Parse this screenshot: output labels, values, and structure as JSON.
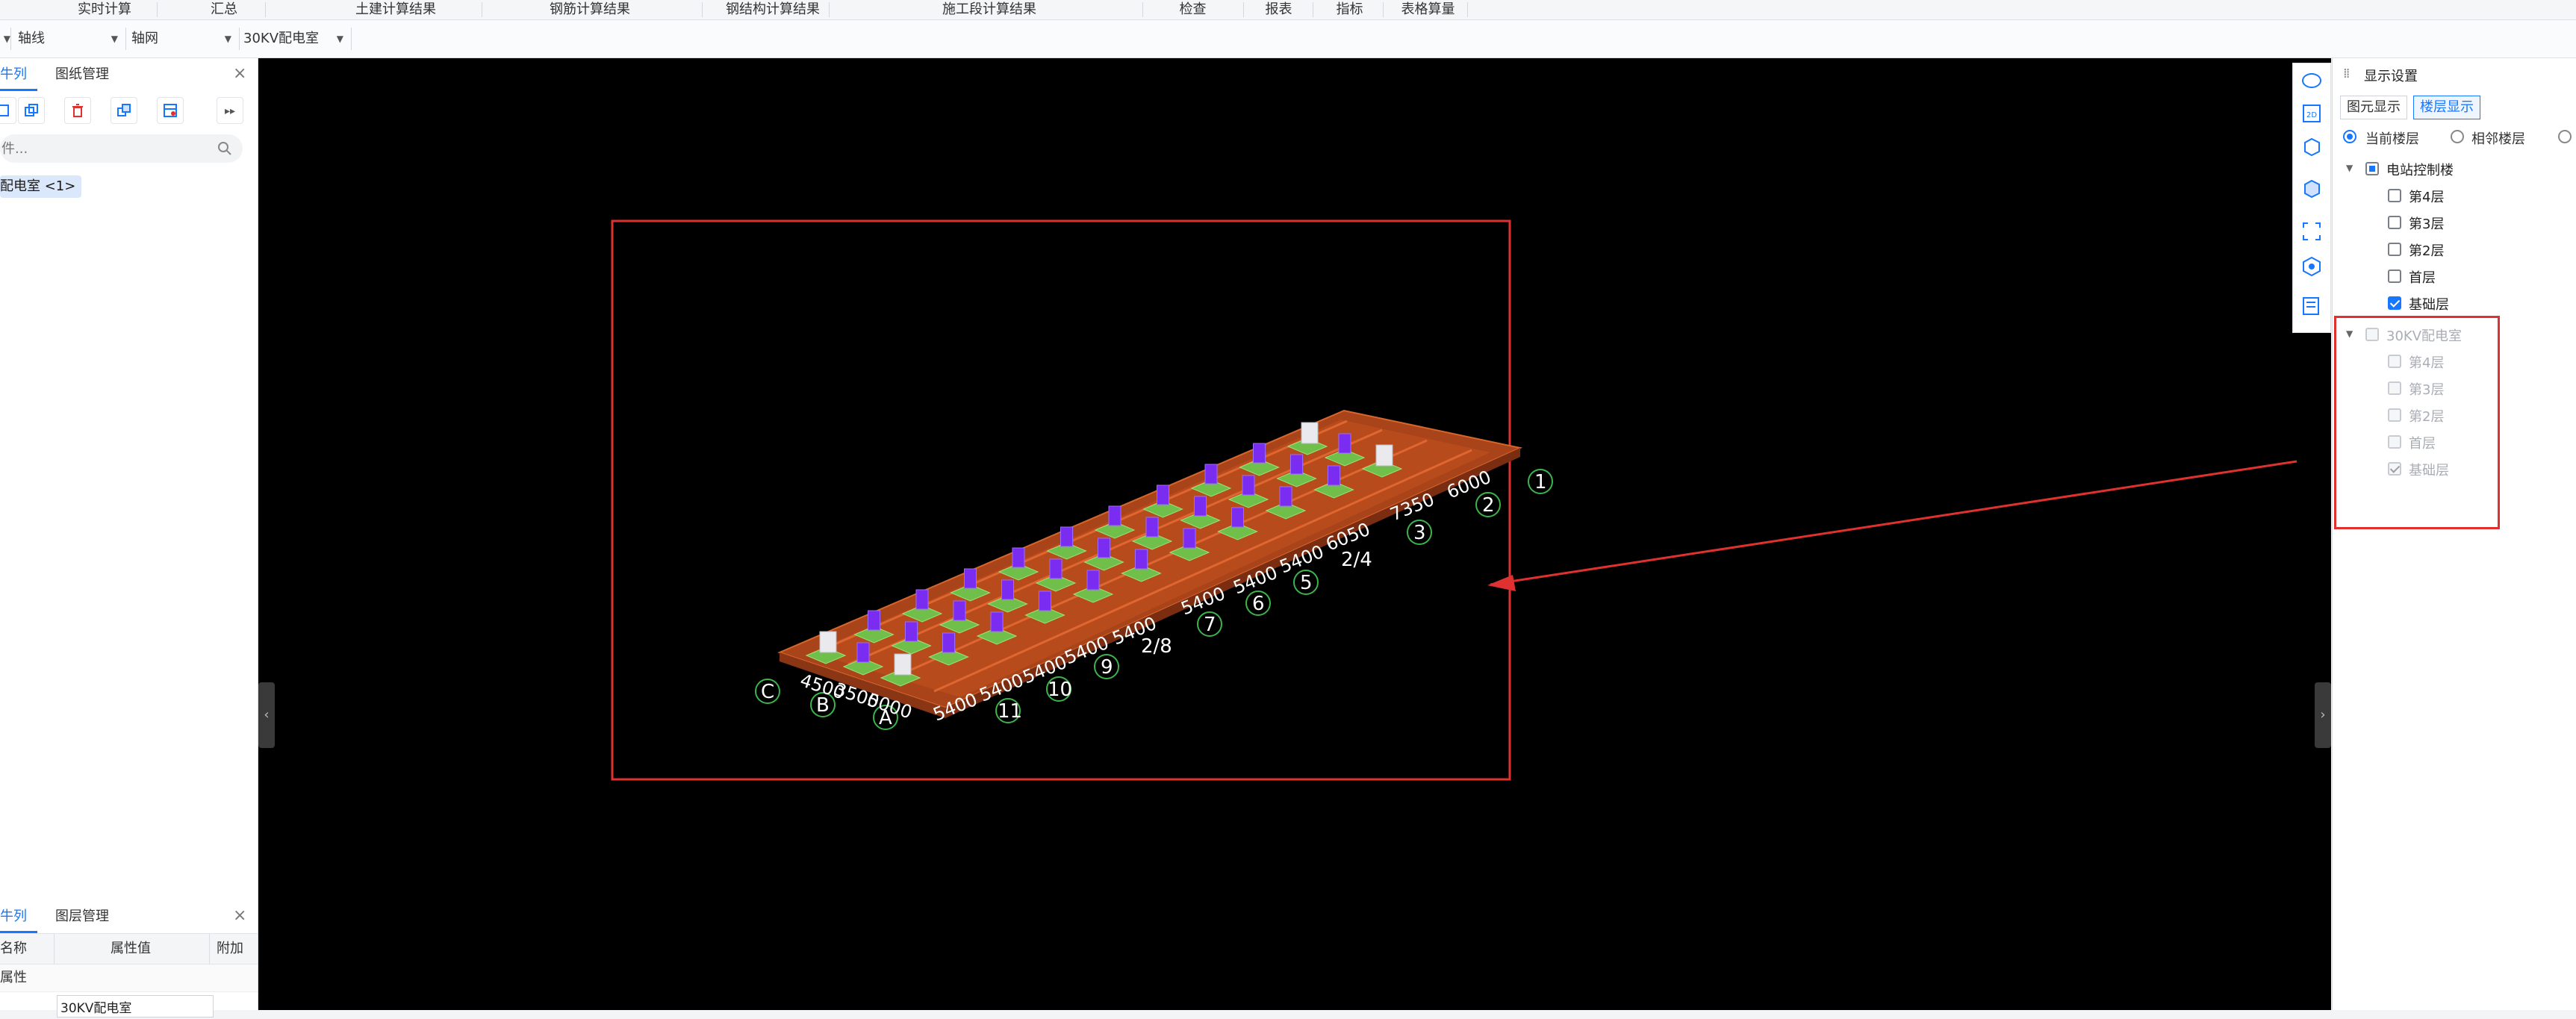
{
  "ribbon": {
    "items": [
      "实时计算",
      "汇总",
      "土建计算结果",
      "钢筋计算结果",
      "钢结构计算结果",
      "施工段计算结果",
      "检查",
      "报表",
      "指标",
      "表格算量"
    ]
  },
  "toolbar": {
    "dropdown_1": "轴线",
    "dropdown_2": "轴网",
    "dropdown_3": "30KV配电室"
  },
  "left_panel": {
    "tab_component_list": "牛列表",
    "tab_drawing_manage": "图纸管理",
    "search_placeholder": "件...",
    "tree_item": "配电室 <1>",
    "bottom_tab_attr_list": "牛列表",
    "bottom_tab_layer_manage": "图层管理",
    "prop_col_name": "名称",
    "prop_col_value": "属性值",
    "prop_col_extra": "附加",
    "prop_group": "属性",
    "prop_value": "30KV配电室"
  },
  "viewport": {
    "axis_numbers": [
      "1",
      "2",
      "3",
      "2/4",
      "5",
      "6",
      "7",
      "2/8",
      "9",
      "10",
      "11"
    ],
    "axis_letters": [
      "C",
      "B",
      "A"
    ],
    "dims_top": [
      "6000",
      "7350",
      "6050",
      "5400",
      "5400",
      "5400"
    ],
    "dims_bottom": [
      "5400",
      "5400",
      "5400",
      "5400",
      "5400"
    ],
    "dims_left": [
      "4500",
      "3500",
      "5000"
    ]
  },
  "right_panel": {
    "title": "显示设置",
    "tab_element_display": "图元显示",
    "tab_floor_display": "楼层显示",
    "radio_current": "当前楼层",
    "radio_adjacent": "相邻楼层",
    "building_1": {
      "name": "电站控制楼",
      "floors": [
        {
          "label": "第4层",
          "checked": false
        },
        {
          "label": "第3层",
          "checked": false
        },
        {
          "label": "第2层",
          "checked": false
        },
        {
          "label": "首层",
          "checked": false
        },
        {
          "label": "基础层",
          "checked": true
        }
      ]
    },
    "building_2": {
      "name": "30KV配电室",
      "floors": [
        {
          "label": "第4层",
          "checked": false
        },
        {
          "label": "第3层",
          "checked": false
        },
        {
          "label": "第2层",
          "checked": false
        },
        {
          "label": "首层",
          "checked": false
        },
        {
          "label": "基础层",
          "checked": true
        }
      ]
    }
  },
  "colors": {
    "accent": "#1677ff",
    "annotation_red": "#e03131",
    "slab": "#b84d1c",
    "footing": "#6fbf4a",
    "column": "#7a2cf0"
  }
}
